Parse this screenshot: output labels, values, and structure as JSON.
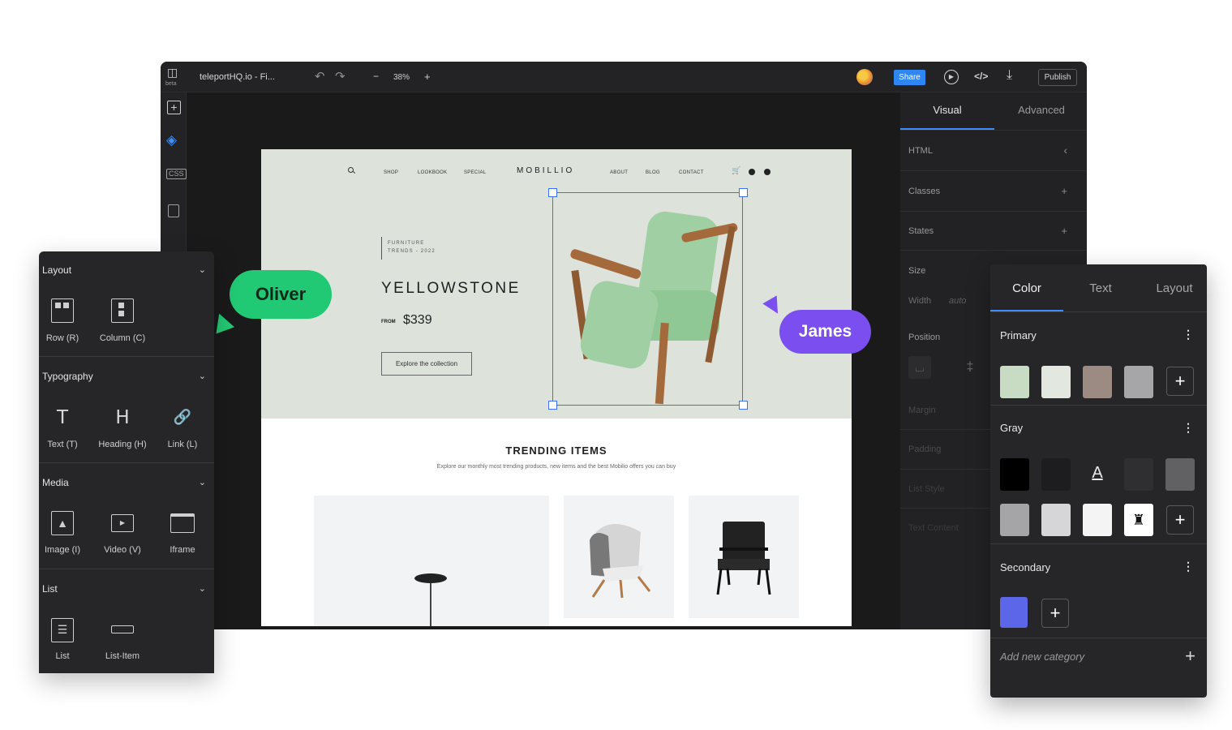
{
  "topbar": {
    "logo_sub": "beta",
    "file_title": "teleportHQ.io - Fi...",
    "zoom_minus": "−",
    "zoom_level": "38%",
    "zoom_plus": "+",
    "share_label": "Share",
    "publish_label": "Publish"
  },
  "right_panel": {
    "tabs": [
      "Visual",
      "Advanced"
    ],
    "rows": {
      "html": "HTML",
      "classes": "Classes",
      "states": "States",
      "size": "Size",
      "width": "Width",
      "width_value": "auto",
      "position": "Position",
      "margin": "Margin",
      "padding": "Padding",
      "list_style": "List Style",
      "text_content": "Text Content"
    }
  },
  "site": {
    "nav_left": [
      "SHOP",
      "LOOKBOOK",
      "SPECIAL"
    ],
    "brand": "MOBILLIO",
    "nav_right": [
      "ABOUT",
      "BLOG",
      "CONTACT"
    ],
    "hero_tag_line1": "FURNITURE",
    "hero_tag_line2": "TRENDS - 2022",
    "hero_title": "YELLOWSTONE",
    "hero_from": "FROM",
    "hero_price": "$339",
    "hero_cta": "Explore the collection",
    "trending_title": "TRENDING ITEMS",
    "trending_sub": "Explore our monthly most trending products, new items and the best Mobilio offers you can buy"
  },
  "collaborators": {
    "oliver": "Oliver",
    "james": "James",
    "oliver_color": "#22c974",
    "james_color": "#7b4ef0"
  },
  "components": {
    "layout_title": "Layout",
    "layout_items": [
      "Row (R)",
      "Column (C)"
    ],
    "typography_title": "Typography",
    "typography_items": [
      "Text (T)",
      "Heading (H)",
      "Link (L)"
    ],
    "media_title": "Media",
    "media_items": [
      "Image (I)",
      "Video (V)",
      "Iframe"
    ],
    "list_title": "List",
    "list_items": [
      "List",
      "List-Item"
    ]
  },
  "color_panel": {
    "tabs": [
      "Color",
      "Text",
      "Layout"
    ],
    "primary_title": "Primary",
    "primary_colors": [
      "#c8dcc4",
      "#e2e8df",
      "#9b8b83",
      "#a6a6a8"
    ],
    "gray_title": "Gray",
    "gray_colors_row1": [
      "#000000",
      "#1d1d1f",
      "#262628",
      "#2f2f31",
      "#616164"
    ],
    "gray_colors_row2": [
      "#a5a5a7",
      "#d6d6d8",
      "#f4f4f4",
      "#ffffff"
    ],
    "secondary_title": "Secondary",
    "secondary_colors": [
      "#5b66e8"
    ],
    "add_category": "Add new category"
  },
  "accent": "#3d8ff7"
}
